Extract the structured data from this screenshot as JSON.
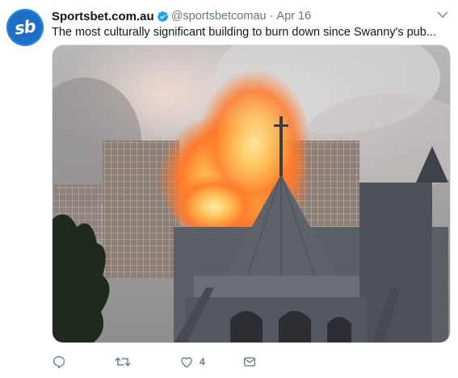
{
  "tweet": {
    "avatar_text": "sb",
    "display_name": "Sportsbet.com.au",
    "handle": "@sportsbetcomau",
    "separator": "·",
    "date": "Apr 16",
    "text": "The most culturally significant building to burn down since Swanny's pub...",
    "media": {
      "icon": "photo-image",
      "description_colors": {
        "smoke": "#cfc9c6",
        "fire": "#ff9a3c",
        "stone": "#5d6168"
      }
    },
    "actions": {
      "reply_icon": "reply-icon",
      "retweet_icon": "retweet-icon",
      "like_icon": "heart-icon",
      "like_count": "4",
      "message_icon": "envelope-icon"
    }
  },
  "colors": {
    "brand_blue": "#1c6fc4",
    "verified_blue": "#1da1f2",
    "secondary_text": "#657786",
    "primary_text": "#14171a"
  }
}
